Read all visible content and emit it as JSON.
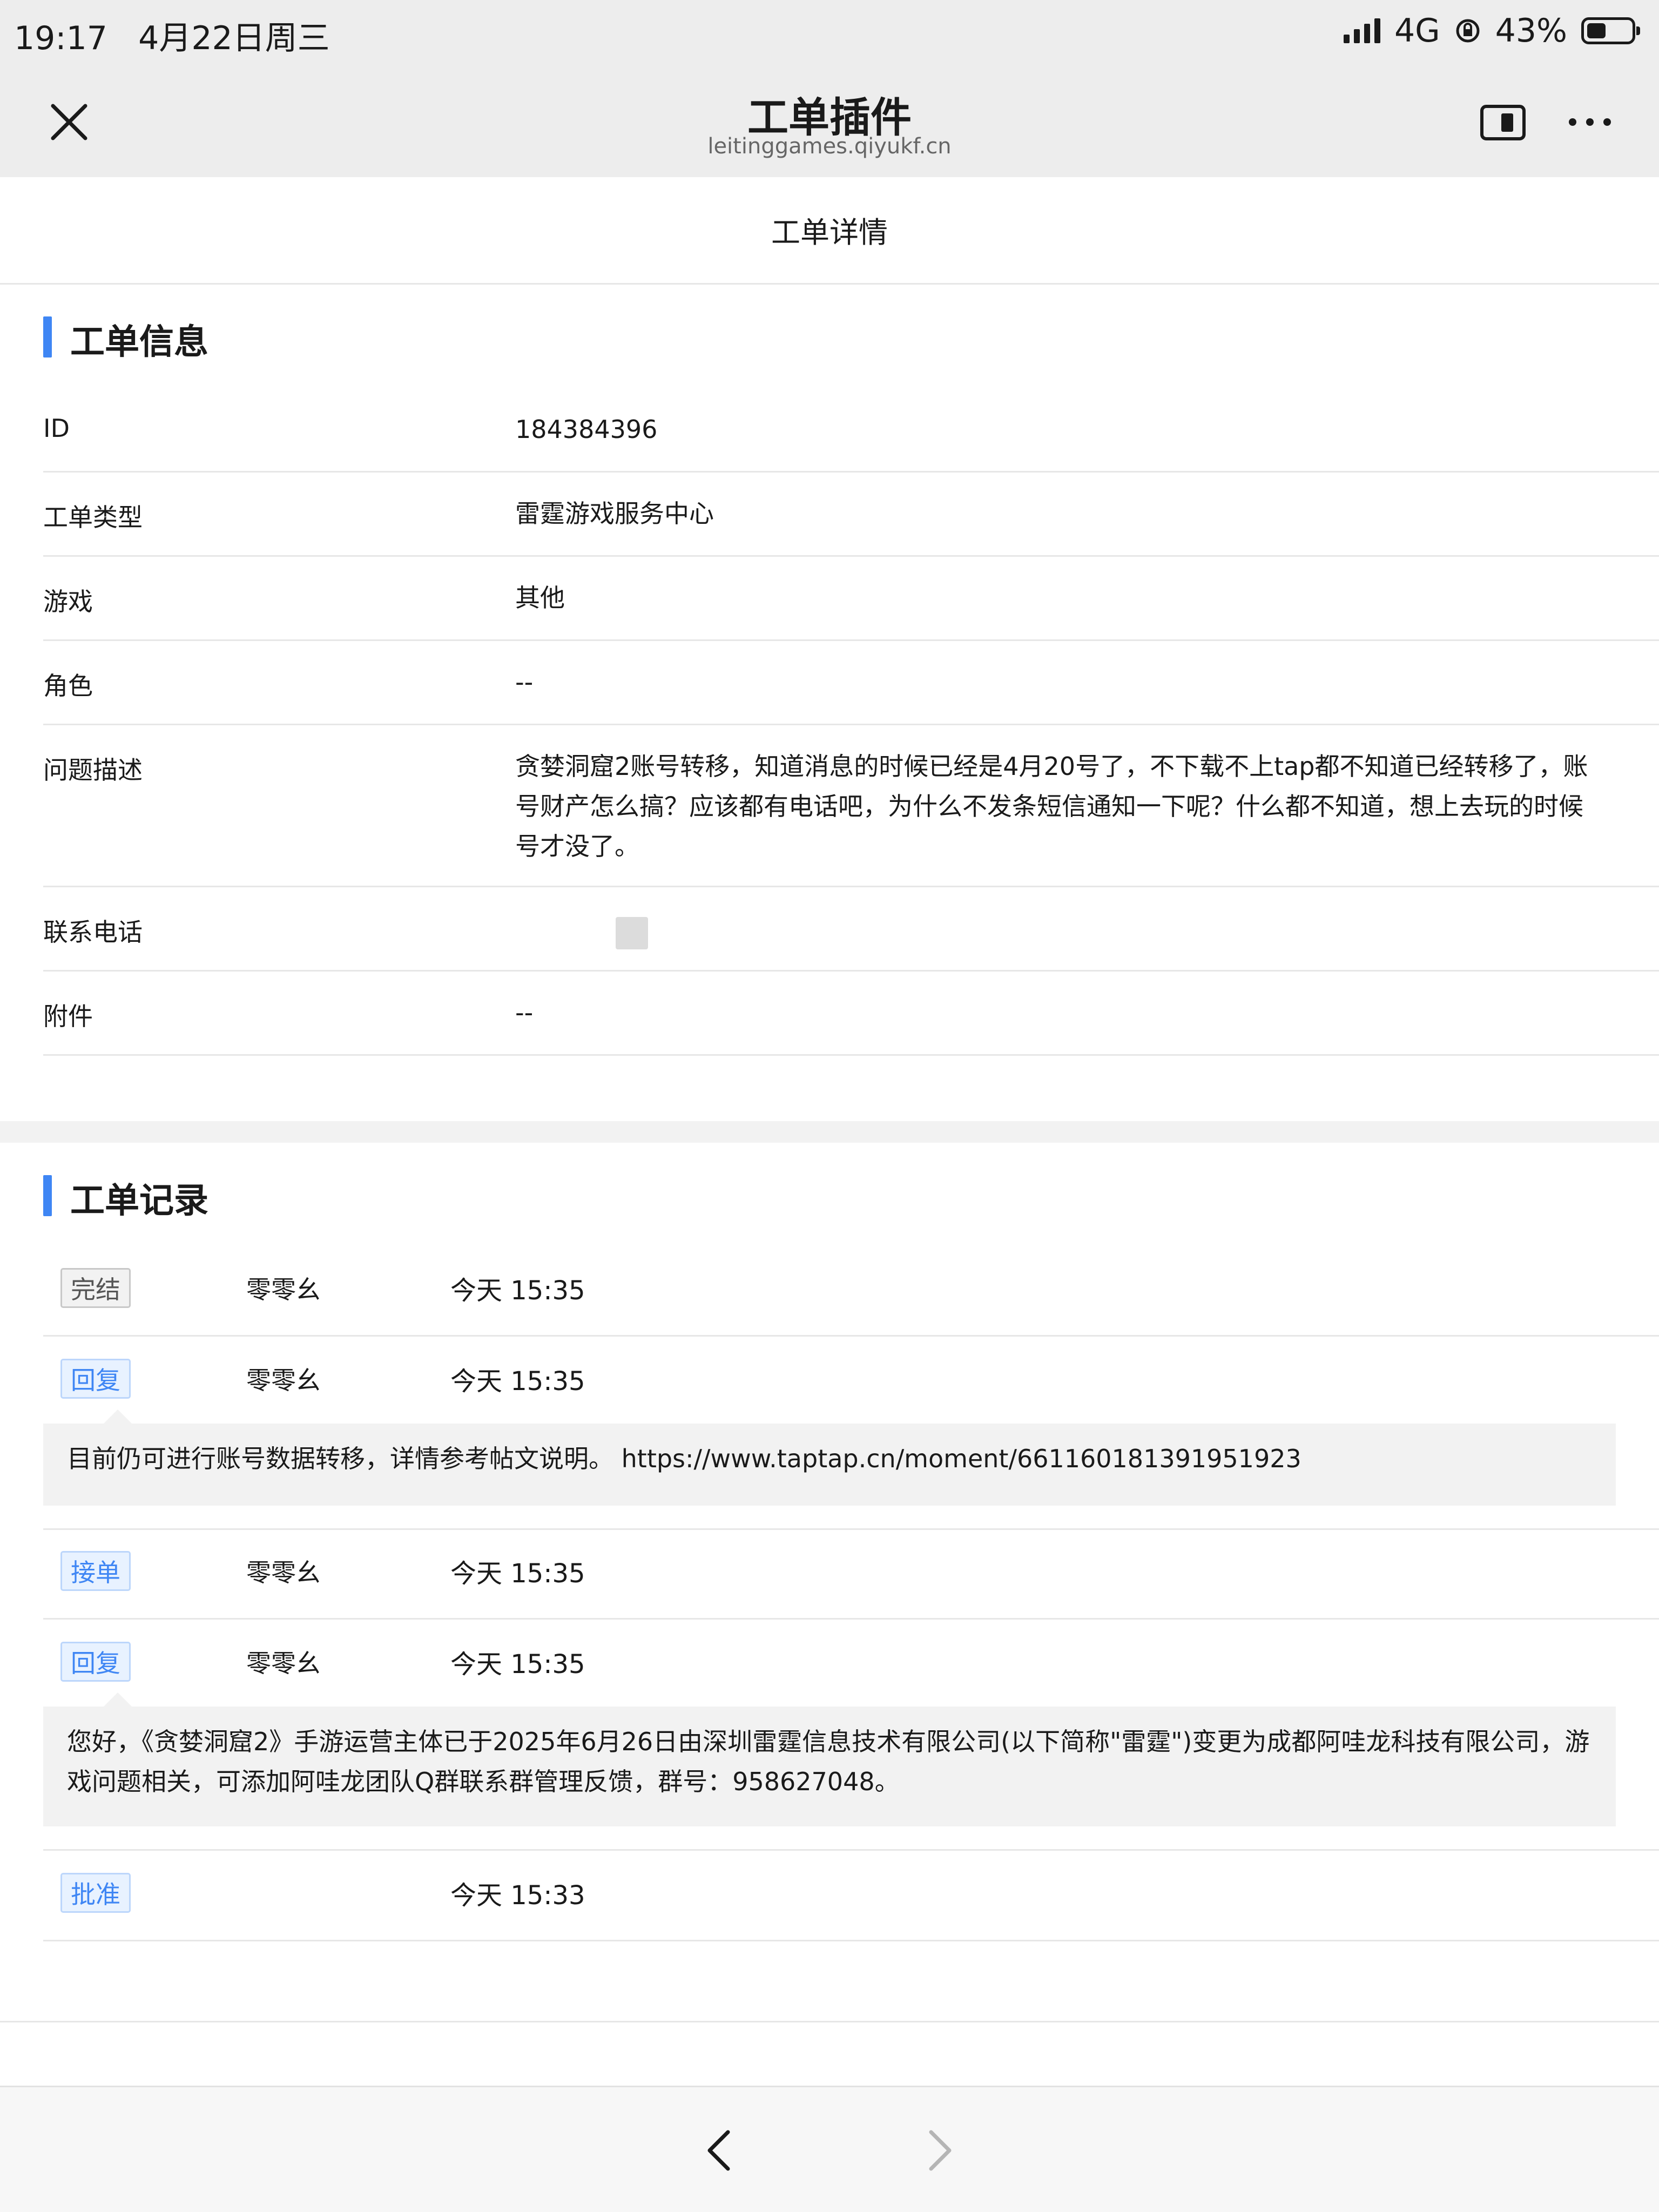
{
  "status_bar": {
    "time": "19:17",
    "date": "4月22日周三",
    "network": "4G",
    "battery": "43%",
    "battery_level": 0.43
  },
  "nav": {
    "title": "工单插件",
    "domain": "leitinggames.qiyukf.cn",
    "icons": [
      "close-icon",
      "floating-window-icon",
      "more-icon"
    ]
  },
  "page_title": "工单详情",
  "info": {
    "heading": "工单信息",
    "rows": [
      {
        "label": "ID",
        "value": "184384396"
      },
      {
        "label": "工单类型",
        "value": "雷霆游戏服务中心"
      },
      {
        "label": "游戏",
        "value": "其他"
      },
      {
        "label": "角色",
        "value": "--"
      },
      {
        "label": "问题描述",
        "value": "贪婪洞窟2账号转移，知道消息的时候已经是4月20号了，不下载不上tap都不知道已经转移了，账号财产怎么搞？应该都有电话吧，为什么不发条短信通知一下呢？什么都不知道，想上去玩的时候号才没了。"
      },
      {
        "label": "联系电话",
        "value": ""
      },
      {
        "label": "附件",
        "value": "--"
      }
    ]
  },
  "records": {
    "heading": "工单记录",
    "items": [
      {
        "tag": "完结",
        "user": "零零幺",
        "time": "今天 15:35"
      },
      {
        "tag": "回复",
        "user": "零零幺",
        "time": "今天 15:35",
        "content": "目前仍可进行账号数据转移，详情参考帖文说明。 https://www.taptap.cn/moment/661160181391951923"
      },
      {
        "tag": "接单",
        "user": "零零幺",
        "time": "今天 15:35"
      },
      {
        "tag": "回复",
        "user": "零零幺",
        "time": "今天 15:35",
        "content": "您好，《贪婪洞窟2》手游运营主体已于2025年6月26日由深圳雷霆信息技术有限公司(以下简称\"雷霆\")变更为成都阿哇龙科技有限公司，游戏问题相关，可添加阿哇龙团队Q群联系群管理反馈，群号：958627048。"
      },
      {
        "tag": "批准",
        "user": "",
        "time": "今天 15:33"
      }
    ]
  },
  "colors": {
    "accent": "#3f86f4",
    "tag_blue_bg": "#e8f2ff",
    "header_bg": "#ededed",
    "reply_bg": "#f2f2f2"
  }
}
